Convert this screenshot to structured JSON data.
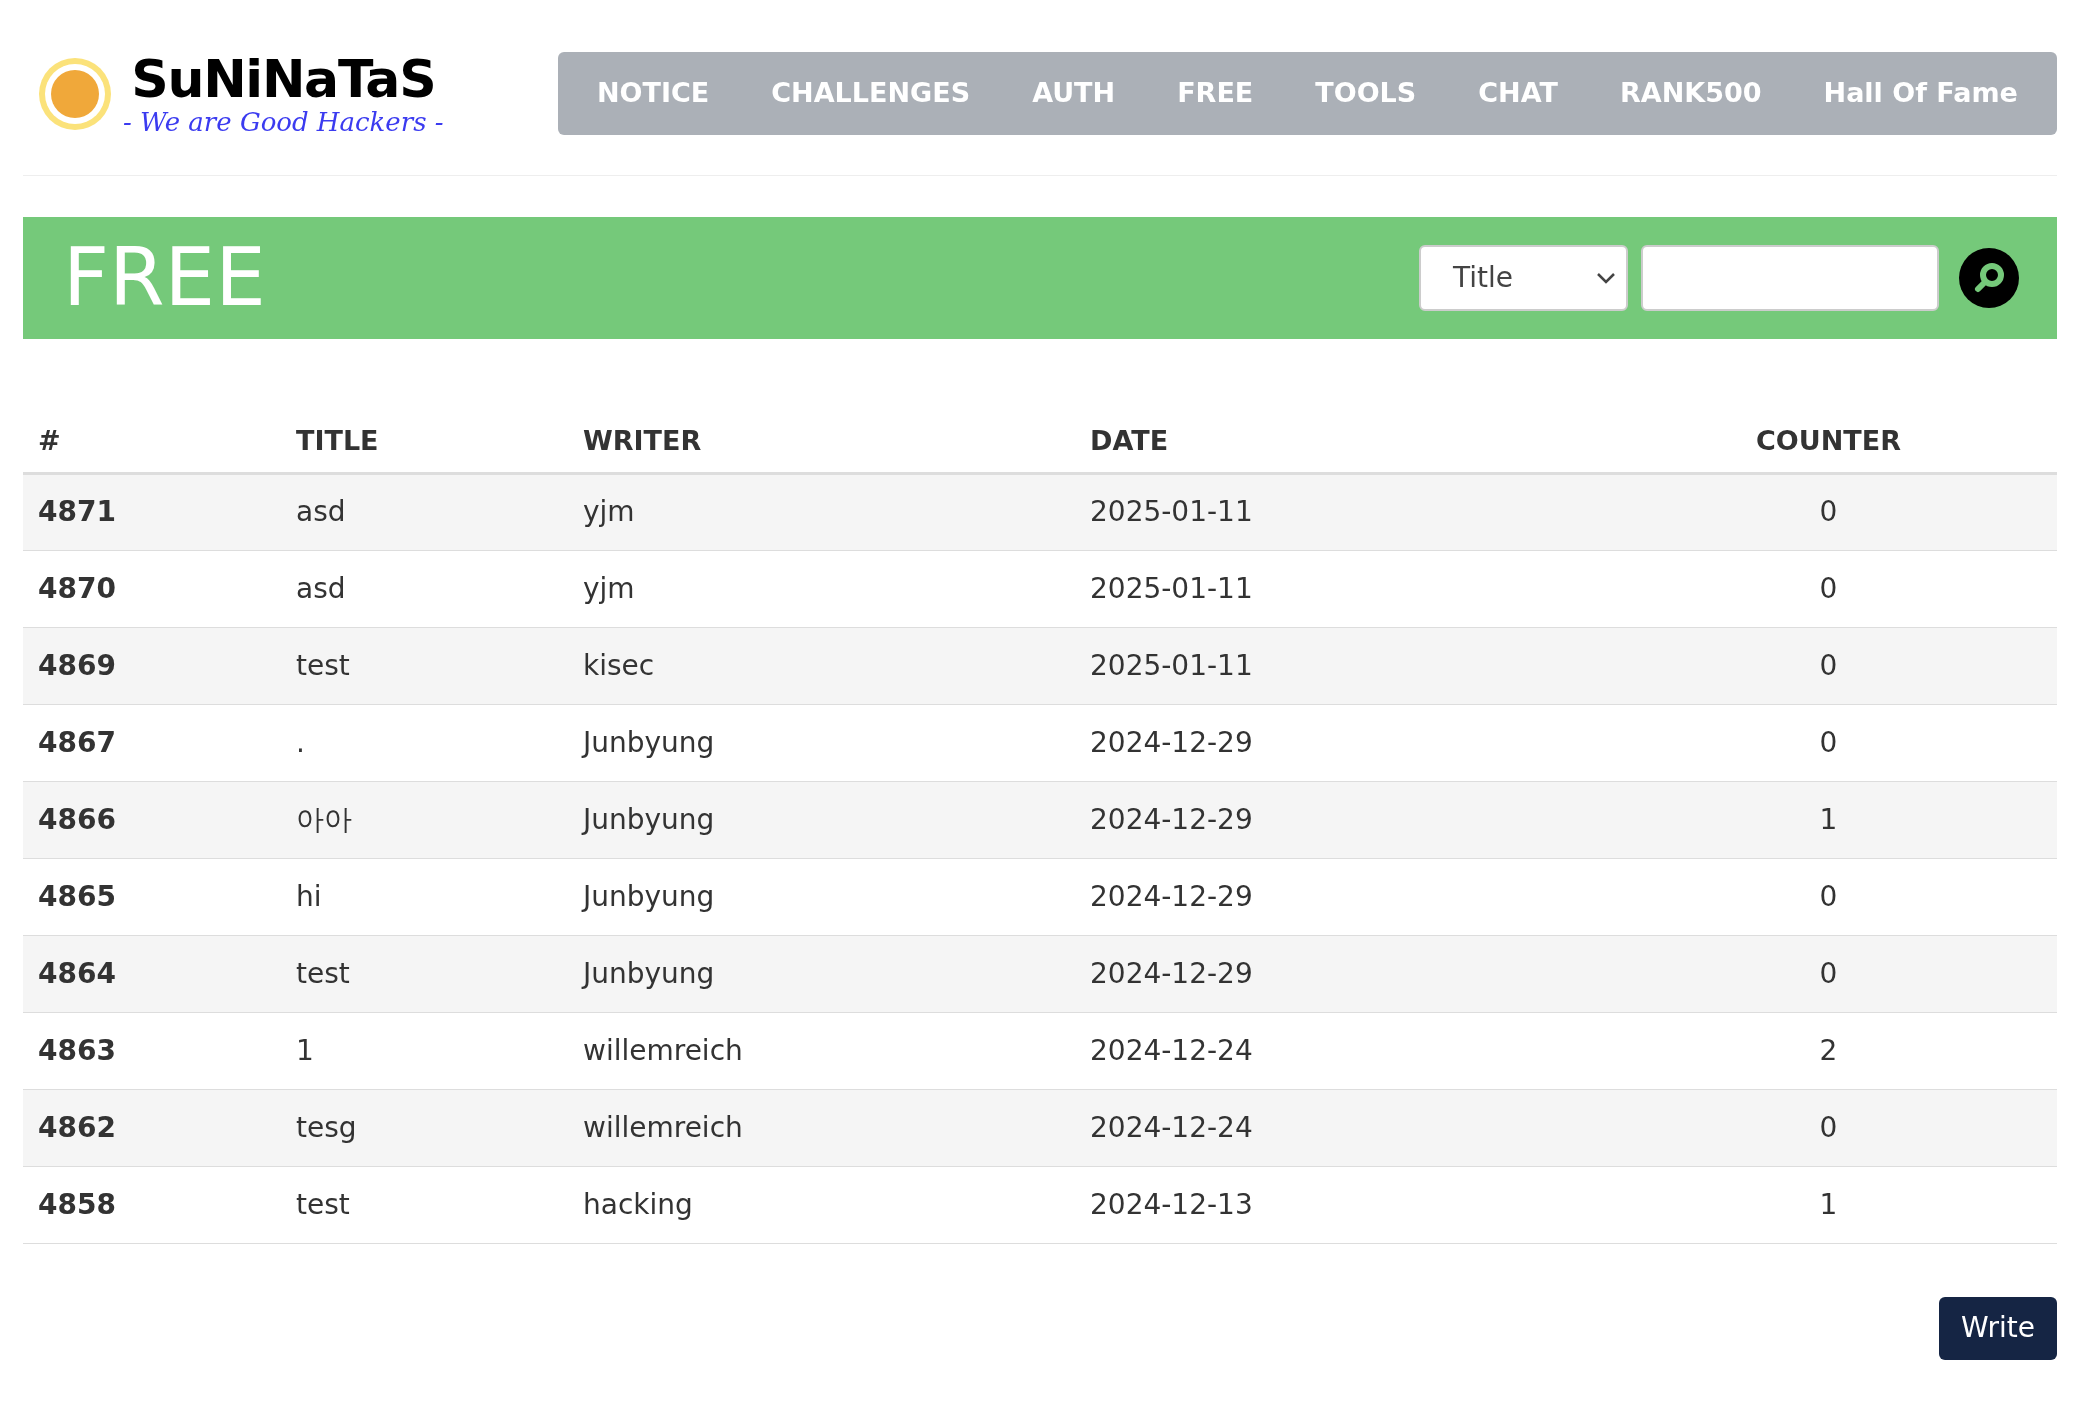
{
  "logo": {
    "name": "SuNiNaTaS",
    "tagline": "- We are Good Hackers -"
  },
  "nav": [
    {
      "label": "NOTICE"
    },
    {
      "label": "CHALLENGES"
    },
    {
      "label": "AUTH"
    },
    {
      "label": "FREE"
    },
    {
      "label": "TOOLS"
    },
    {
      "label": "CHAT"
    },
    {
      "label": "RANK500"
    },
    {
      "label": "Hall Of Fame"
    }
  ],
  "board": {
    "title": "FREE",
    "search_field": {
      "value": "Title"
    }
  },
  "table": {
    "columns": [
      "#",
      "TITLE",
      "WRITER",
      "DATE",
      "COUNTER"
    ],
    "rows": [
      [
        "4871",
        "asd",
        "yjm",
        "2025-01-11",
        "0"
      ],
      [
        "4870",
        "asd",
        "yjm",
        "2025-01-11",
        "0"
      ],
      [
        "4869",
        "test",
        "kisec",
        "2025-01-11",
        "0"
      ],
      [
        "4867",
        ".",
        "Junbyung",
        "2024-12-29",
        "0"
      ],
      [
        "4866",
        "아아",
        "Junbyung",
        "2024-12-29",
        "1"
      ],
      [
        "4865",
        "hi",
        "Junbyung",
        "2024-12-29",
        "0"
      ],
      [
        "4864",
        "test",
        "Junbyung",
        "2024-12-29",
        "0"
      ],
      [
        "4863",
        "1",
        "willemreich",
        "2024-12-24",
        "2"
      ],
      [
        "4862",
        "tesg",
        "willemreich",
        "2024-12-24",
        "0"
      ],
      [
        "4858",
        "test",
        "hacking",
        "2024-12-13",
        "1"
      ]
    ]
  },
  "write_button": "Write"
}
